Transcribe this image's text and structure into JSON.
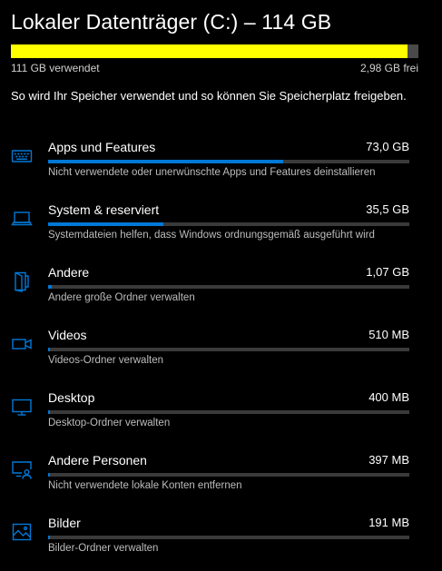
{
  "drive": {
    "title": "Lokaler Datenträger (C:) – 114 GB",
    "used_label": "111 GB verwendet",
    "free_label": "2,98 GB frei",
    "used_fraction": 0.974,
    "bar_color": "#ffff00"
  },
  "description": "So wird Ihr Speicher verwendet und so können Sie Speicherplatz freigeben.",
  "accent_color": "#0078d7",
  "categories": [
    {
      "name": "Apps und Features",
      "size": "73,0 GB",
      "description": "Nicht verwendete oder unerwünschte Apps und Features deinstallieren",
      "icon": "apps-keyboard-icon",
      "fraction": 0.65
    },
    {
      "name": "System & reserviert",
      "size": "35,5 GB",
      "description": "Systemdateien helfen, dass Windows ordnungsgemäß ausgeführt wird",
      "icon": "laptop-icon",
      "fraction": 0.32
    },
    {
      "name": "Andere",
      "size": "1,07 GB",
      "description": "Andere große Ordner verwalten",
      "icon": "folder-icon",
      "fraction": 0.01
    },
    {
      "name": "Videos",
      "size": "510 MB",
      "description": "Videos-Ordner verwalten",
      "icon": "video-camera-icon",
      "fraction": 0.005
    },
    {
      "name": "Desktop",
      "size": "400 MB",
      "description": "Desktop-Ordner verwalten",
      "icon": "monitor-icon",
      "fraction": 0.004
    },
    {
      "name": "Andere Personen",
      "size": "397 MB",
      "description": "Nicht verwendete lokale Konten entfernen",
      "icon": "person-screen-icon",
      "fraction": 0.004
    },
    {
      "name": "Bilder",
      "size": "191 MB",
      "description": "Bilder-Ordner verwalten",
      "icon": "picture-icon",
      "fraction": 0.002
    }
  ]
}
